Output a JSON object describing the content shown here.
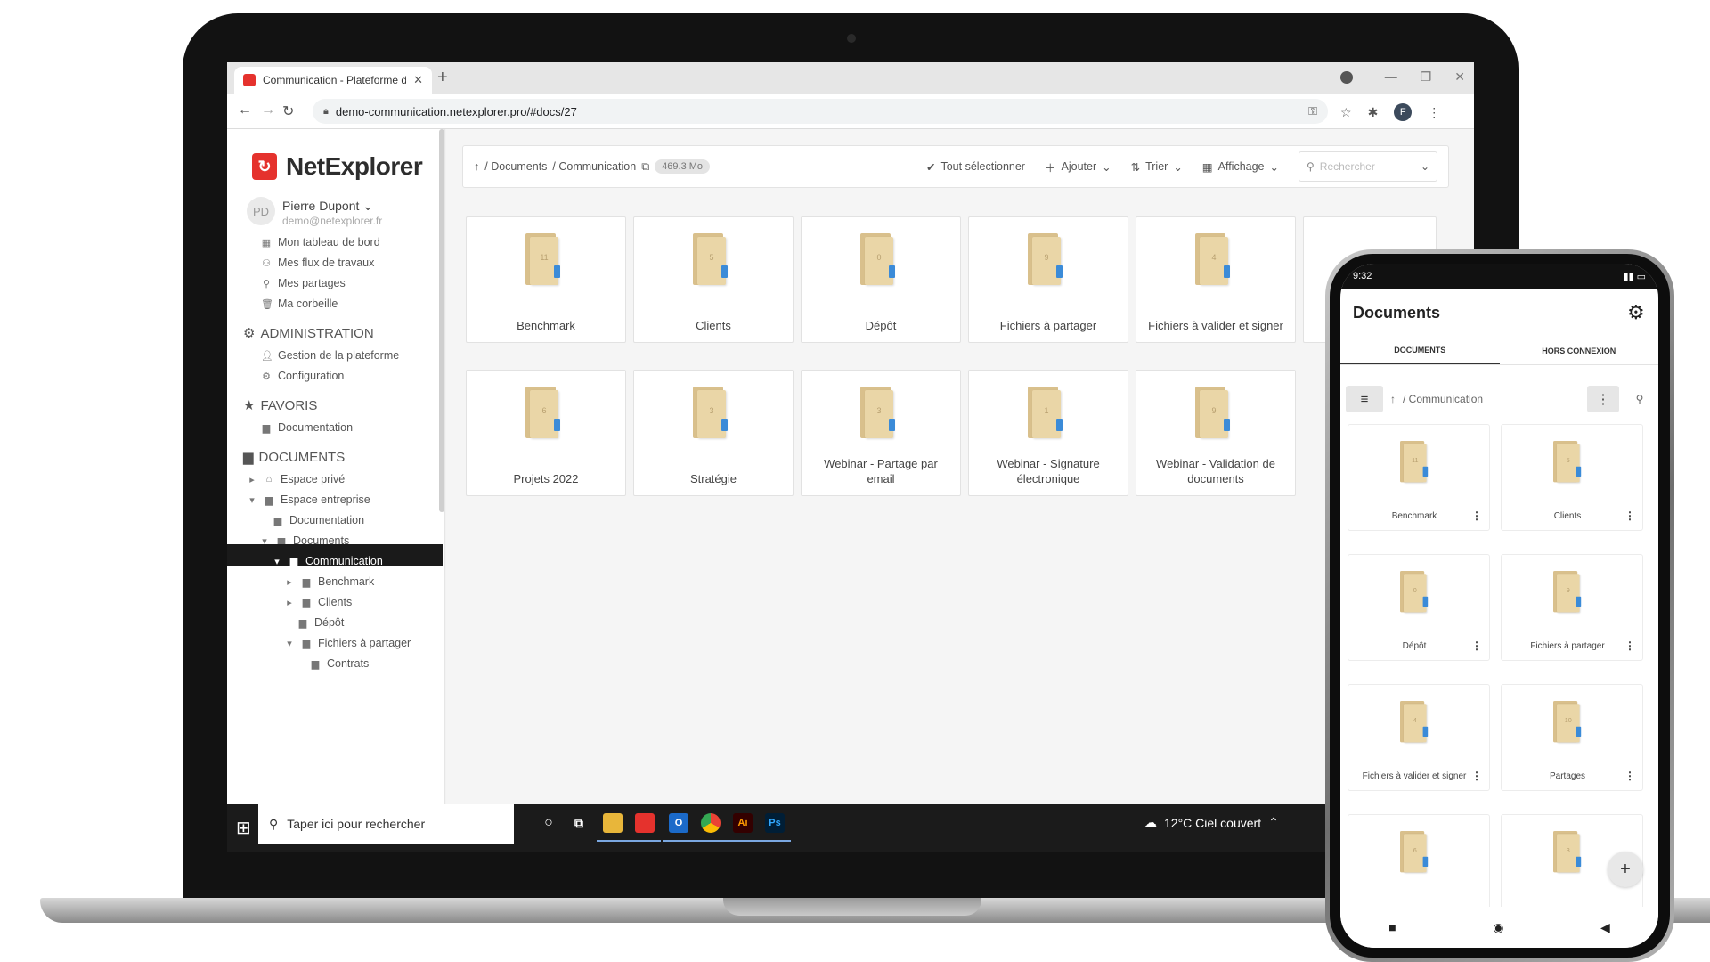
{
  "browser": {
    "tab_title": "Communication - Plateforme de",
    "new_tab": "+",
    "url": "demo-communication.netexplorer.pro/#docs/27",
    "profile_initial": "F"
  },
  "app": {
    "logo": "NetExplorer",
    "user": {
      "initials": "PD",
      "name": "Pierre Dupont",
      "email": "demo@netexplorer.fr"
    },
    "nav": [
      {
        "label": "Mon tableau de bord",
        "icon": "dashboard-icon"
      },
      {
        "label": "Mes flux de travaux",
        "icon": "workflow-icon"
      },
      {
        "label": "Mes partages",
        "icon": "share-icon"
      },
      {
        "label": "Ma corbeille",
        "icon": "trash-icon"
      }
    ],
    "admin": {
      "title": "ADMINISTRATION",
      "items": [
        {
          "label": "Gestion de la plateforme"
        },
        {
          "label": "Configuration"
        }
      ]
    },
    "favoris": {
      "title": "FAVORIS",
      "items": [
        {
          "label": "Documentation"
        }
      ]
    },
    "documents": {
      "title": "DOCUMENTS",
      "tree": [
        {
          "label": "Espace privé"
        },
        {
          "label": "Espace entreprise"
        },
        {
          "label": "Documentation"
        },
        {
          "label": "Documents"
        },
        {
          "label": "Communication"
        },
        {
          "label": "Benchmark"
        },
        {
          "label": "Clients"
        },
        {
          "label": "Dépôt"
        },
        {
          "label": "Fichiers à partager"
        },
        {
          "label": "Contrats"
        }
      ]
    },
    "breadcrumb": {
      "root": "/ Documents",
      "current": "/ Communication",
      "size": "469.3 Mo"
    },
    "toolbar": {
      "select_all": "Tout sélectionner",
      "add": "Ajouter",
      "sort": "Trier",
      "display": "Affichage",
      "search_placeholder": "Rechercher"
    },
    "folders": [
      {
        "name": "Benchmark",
        "count": "11"
      },
      {
        "name": "Clients",
        "count": "5"
      },
      {
        "name": "Dépôt",
        "count": "0"
      },
      {
        "name": "Fichiers à partager",
        "count": "9"
      },
      {
        "name": "Fichiers à valider et signer",
        "count": "4"
      },
      {
        "name": "Projets 2022",
        "count": "6"
      },
      {
        "name": "Stratégie",
        "count": "3"
      },
      {
        "name": "Webinar - Partage par email",
        "count": "3"
      },
      {
        "name": "Webinar - Signature électronique",
        "count": "1"
      },
      {
        "name": "Webinar - Validation de documents",
        "count": "9"
      }
    ]
  },
  "taskbar": {
    "search_placeholder": "Taper ici pour rechercher",
    "weather": "12°C  Ciel couvert",
    "apps": [
      {
        "name": "cortana-icon",
        "label": "O"
      },
      {
        "name": "task-view-icon",
        "label": "⧉"
      },
      {
        "name": "file-explorer-icon",
        "label": "▆"
      },
      {
        "name": "netexplorer-app-icon",
        "label": ""
      },
      {
        "name": "outlook-icon",
        "label": "O"
      },
      {
        "name": "chrome-icon",
        "label": ""
      },
      {
        "name": "illustrator-icon",
        "label": "Ai"
      },
      {
        "name": "photoshop-icon",
        "label": "Ps"
      }
    ]
  },
  "phone": {
    "time": "9:32",
    "title": "Documents",
    "tabs": [
      "DOCUMENTS",
      "HORS CONNEXION"
    ],
    "path": "/ Communication",
    "folders": [
      {
        "name": "Benchmark",
        "count": "11"
      },
      {
        "name": "Clients",
        "count": "5"
      },
      {
        "name": "Dépôt",
        "count": "0"
      },
      {
        "name": "Fichiers à partager",
        "count": "9"
      },
      {
        "name": "Fichiers à valider et signer",
        "count": "4"
      },
      {
        "name": "Partages",
        "count": "10"
      },
      {
        "name": "",
        "count": "6"
      },
      {
        "name": "",
        "count": "3"
      }
    ],
    "fab": "+"
  },
  "colors": {
    "brand_red": "#e5322d",
    "folder": "#ead6a7",
    "taskbar": "#1b1b1b"
  }
}
